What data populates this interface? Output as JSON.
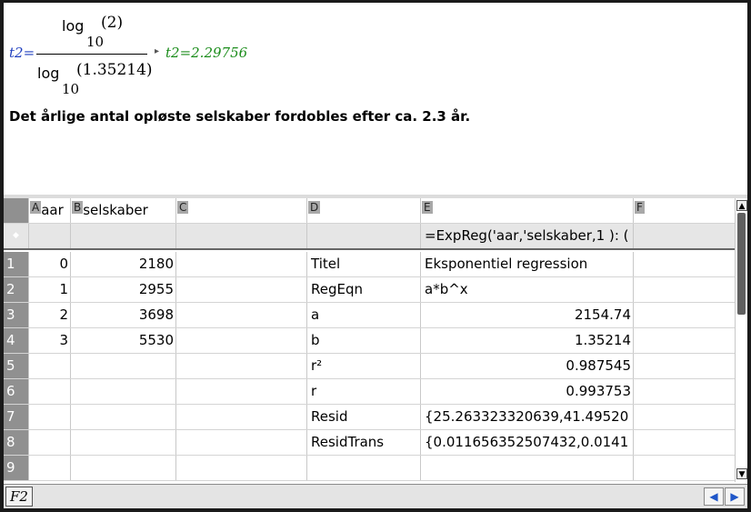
{
  "notes": {
    "lhs": "t2=",
    "numerator": {
      "fn": "log",
      "base": "10",
      "arg": "(2)"
    },
    "denominator": {
      "fn": "log",
      "base": "10",
      "arg": "(1.35214)"
    },
    "arrow": "▸",
    "result": "t2=2.29756",
    "sentence": "Det årlige antal opløste selskaber fordobles efter ca. 2.3 år."
  },
  "spreadsheet": {
    "columns": [
      {
        "letter": "A",
        "name": "aar"
      },
      {
        "letter": "B",
        "name": "selskaber"
      },
      {
        "letter": "C",
        "name": ""
      },
      {
        "letter": "D",
        "name": ""
      },
      {
        "letter": "E",
        "name": ""
      },
      {
        "letter": "F",
        "name": ""
      }
    ],
    "formula_marker": "◆",
    "formula_E": "=ExpReg('aar,'selskaber,1 ): (",
    "rows": [
      {
        "n": "1",
        "A": "0",
        "B": "2180",
        "D": "Titel",
        "E": "Eksponentiel regression"
      },
      {
        "n": "2",
        "A": "1",
        "B": "2955",
        "D": "RegEqn",
        "E": "a*b^x"
      },
      {
        "n": "3",
        "A": "2",
        "B": "3698",
        "D": "a",
        "E": "2154.74"
      },
      {
        "n": "4",
        "A": "3",
        "B": "5530",
        "D": "b",
        "E": "1.35214"
      },
      {
        "n": "5",
        "A": "",
        "B": "",
        "D": "r²",
        "E": "0.987545"
      },
      {
        "n": "6",
        "A": "",
        "B": "",
        "D": "r",
        "E": "0.993753"
      },
      {
        "n": "7",
        "A": "",
        "B": "",
        "D": "Resid",
        "E": "{25.263323320639,41.49520"
      },
      {
        "n": "8",
        "A": "",
        "B": "",
        "D": "ResidTrans",
        "E": "{0.011656352507432,0.0141"
      },
      {
        "n": "9",
        "A": "",
        "B": "",
        "D": "",
        "E": ""
      }
    ]
  },
  "statusbar": {
    "variable": "F2",
    "prev": "◀",
    "next": "▶"
  },
  "scroll": {
    "up": "▲",
    "down": "▼"
  },
  "colors": {
    "result_green": "#1a8c1a",
    "formula_blue": "#1f3fbf",
    "row_header": "#909090"
  }
}
